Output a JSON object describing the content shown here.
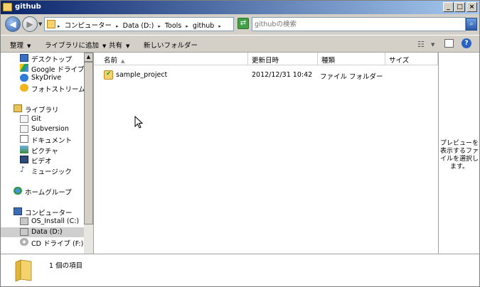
{
  "window": {
    "title": "github"
  },
  "address": {
    "crumbs": [
      "コンピューター",
      "Data (D:)",
      "Tools",
      "github"
    ],
    "search_placeholder": "githubの検索"
  },
  "toolbar": {
    "organize": "整理",
    "add_to_library": "ライブラリに追加",
    "share": "共有",
    "new_folder": "新しいフォルダー"
  },
  "nav": {
    "items": [
      {
        "label": "デスクトップ",
        "icon": "desktop-icon"
      },
      {
        "label": "Google ドライブ",
        "icon": "google-drive-icon"
      },
      {
        "label": "SkyDrive",
        "icon": "skydrive-icon"
      },
      {
        "label": "フォトストリーム",
        "icon": "photostream-icon"
      },
      {
        "label": "ライブラリ",
        "icon": "library-icon"
      },
      {
        "label": "Git",
        "icon": "library-git-icon"
      },
      {
        "label": "Subversion",
        "icon": "library-subversion-icon"
      },
      {
        "label": "ドキュメント",
        "icon": "documents-icon"
      },
      {
        "label": "ピクチャ",
        "icon": "pictures-icon"
      },
      {
        "label": "ビデオ",
        "icon": "videos-icon"
      },
      {
        "label": "ミュージック",
        "icon": "music-icon"
      },
      {
        "label": "ホームグループ",
        "icon": "homegroup-icon"
      },
      {
        "label": "コンピューター",
        "icon": "computer-icon"
      },
      {
        "label": "OS_Install (C:)",
        "icon": "drive-c-icon"
      },
      {
        "label": "Data (D:)",
        "icon": "drive-d-icon"
      },
      {
        "label": "CD ドライブ (F:) HD",
        "icon": "cd-drive-icon"
      }
    ]
  },
  "files": {
    "columns": [
      "名前",
      "更新日時",
      "種類",
      "サイズ"
    ],
    "rows": [
      {
        "name": "sample_project",
        "modified": "2012/12/31 10:42",
        "type": "ファイル フォルダー",
        "size": ""
      }
    ]
  },
  "preview": {
    "message": "プレビューを表示するファイルを選択します。"
  },
  "details": {
    "count": "1 個の項目"
  }
}
